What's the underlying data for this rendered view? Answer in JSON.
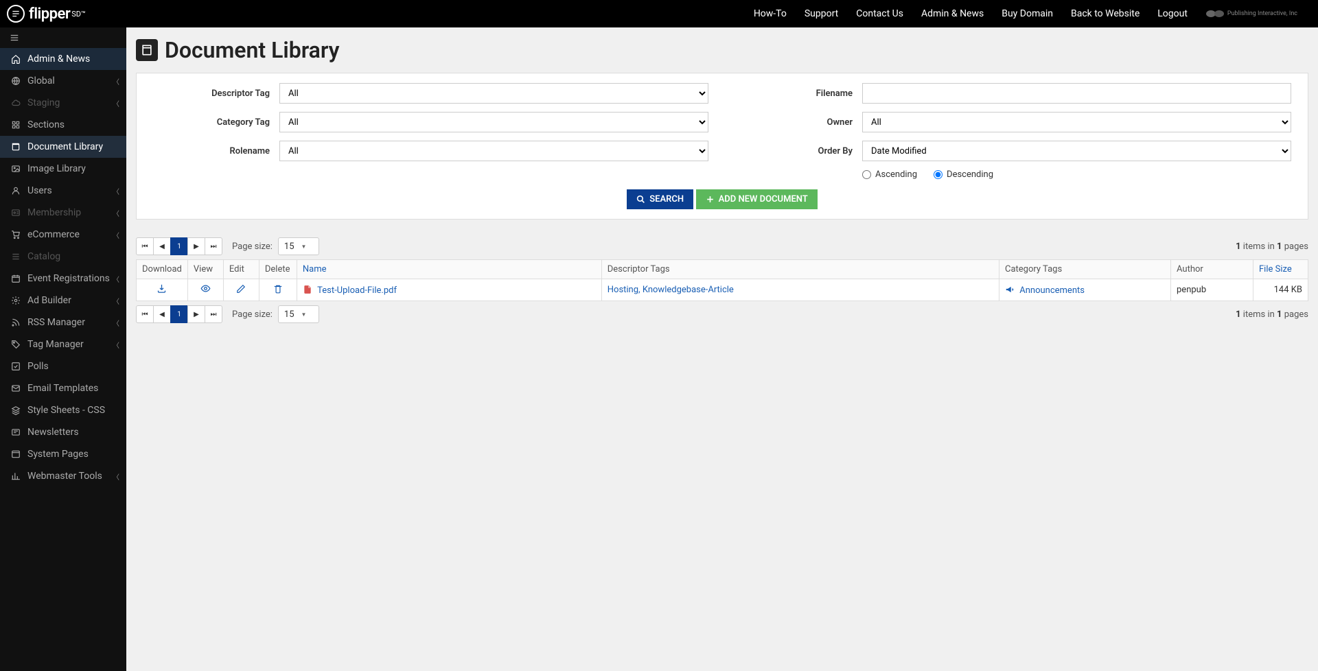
{
  "brand": {
    "name": "flipper",
    "suffix": "SD™"
  },
  "topnav": [
    "How-To",
    "Support",
    "Contact Us",
    "Admin & News",
    "Buy Domain",
    "Back to Website",
    "Logout"
  ],
  "corp": "Publishing Interactive, Inc",
  "sidebar": [
    {
      "label": "Admin & News",
      "icon": "home",
      "expandable": false,
      "state": "active"
    },
    {
      "label": "Global",
      "icon": "globe",
      "expandable": true
    },
    {
      "label": "Staging",
      "icon": "cloud",
      "expandable": true,
      "state": "disabled"
    },
    {
      "label": "Sections",
      "icon": "puzzle",
      "expandable": false
    },
    {
      "label": "Document Library",
      "icon": "book",
      "expandable": false,
      "state": "selected"
    },
    {
      "label": "Image Library",
      "icon": "image",
      "expandable": false
    },
    {
      "label": "Users",
      "icon": "user",
      "expandable": true
    },
    {
      "label": "Membership",
      "icon": "id",
      "expandable": true,
      "state": "disabled"
    },
    {
      "label": "eCommerce",
      "icon": "cart",
      "expandable": true
    },
    {
      "label": "Catalog",
      "icon": "list",
      "expandable": false,
      "state": "disabled"
    },
    {
      "label": "Event Registrations",
      "icon": "calendar",
      "expandable": true
    },
    {
      "label": "Ad Builder",
      "icon": "gears",
      "expandable": true
    },
    {
      "label": "RSS Manager",
      "icon": "rss",
      "expandable": true
    },
    {
      "label": "Tag Manager",
      "icon": "tag",
      "expandable": true
    },
    {
      "label": "Polls",
      "icon": "check",
      "expandable": false
    },
    {
      "label": "Email Templates",
      "icon": "mail",
      "expandable": false
    },
    {
      "label": "Style Sheets - CSS",
      "icon": "layers",
      "expandable": false
    },
    {
      "label": "Newsletters",
      "icon": "news",
      "expandable": false
    },
    {
      "label": "System Pages",
      "icon": "window",
      "expandable": false
    },
    {
      "label": "Webmaster Tools",
      "icon": "chart",
      "expandable": true
    }
  ],
  "page": {
    "title": "Document Library"
  },
  "filters": {
    "descriptor_label": "Descriptor Tag",
    "descriptor_value": "All",
    "category_label": "Category Tag",
    "category_value": "All",
    "rolename_label": "Rolename",
    "rolename_value": "All",
    "filename_label": "Filename",
    "filename_value": "",
    "owner_label": "Owner",
    "owner_value": "All",
    "orderby_label": "Order By",
    "orderby_value": "Date Modified",
    "asc_label": "Ascending",
    "desc_label": "Descending",
    "sort_dir": "desc"
  },
  "buttons": {
    "search": "SEARCH",
    "add": "ADD NEW DOCUMENT"
  },
  "pager": {
    "current": "1",
    "pagesize_label": "Page size:",
    "pagesize": "15",
    "items": "1",
    "pages": "1",
    "summary_items": "items in",
    "summary_pages": "pages"
  },
  "table": {
    "headers": {
      "download": "Download",
      "view": "View",
      "edit": "Edit",
      "delete": "Delete",
      "name": "Name",
      "descriptor": "Descriptor Tags",
      "category": "Category Tags",
      "author": "Author",
      "filesize": "File Size"
    },
    "rows": [
      {
        "name": "Test-Upload-File.pdf",
        "descriptor": "Hosting, Knowledgebase-Article",
        "category": "Announcements",
        "author": "penpub",
        "filesize": "144 KB"
      }
    ]
  }
}
